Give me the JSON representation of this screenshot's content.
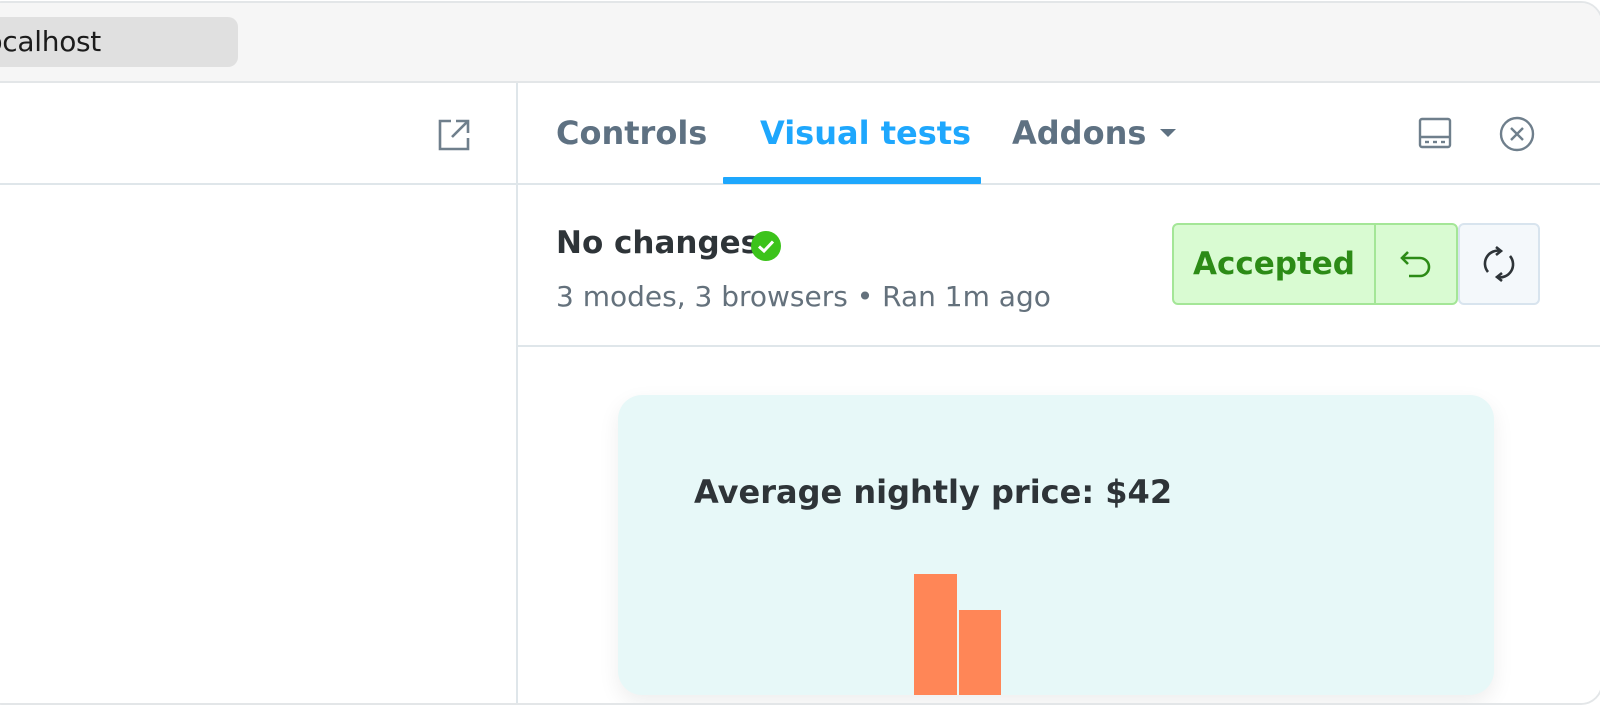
{
  "browser": {
    "url": "localhost"
  },
  "tabs": [
    {
      "label": "Controls"
    },
    {
      "label": "Visual tests"
    },
    {
      "label": "Addons"
    }
  ],
  "status": {
    "title": "No changes",
    "subtitle": "3 modes, 3 browsers • Ran 1m ago",
    "accepted_label": "Accepted"
  },
  "preview": {
    "card_title": "Average nightly price: $42",
    "bar_color": "#ff8657"
  },
  "icons": {
    "open": "external-link-icon",
    "panel": "panel-layout-icon",
    "close": "close-icon",
    "check": "check-circle-icon",
    "undo": "undo-icon",
    "rerun": "sync-icon"
  },
  "colors": {
    "accent": "#1ea7fd",
    "success": "#2c8b16",
    "success_bg": "#d9fbd2"
  }
}
